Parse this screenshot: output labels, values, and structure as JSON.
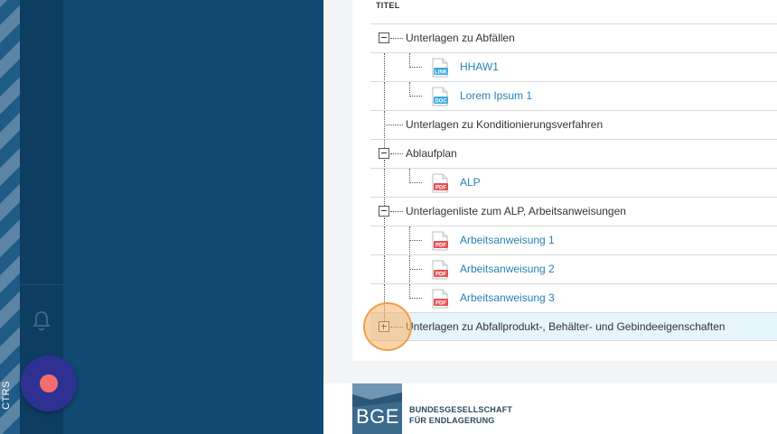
{
  "sidebar": {
    "side_label": "CTRS",
    "bell_icon": "bell-icon",
    "fab_icon": "record-dot-icon"
  },
  "table": {
    "column_header": "TITEL",
    "rows": [
      {
        "label": "Unterlagen zu Abfällen",
        "type": "folder",
        "expanded": true
      },
      {
        "label": "HHAW1",
        "type": "link",
        "icon": "link-icon"
      },
      {
        "label": "Lorem Ipsum 1",
        "type": "doc",
        "icon": "doc-icon"
      },
      {
        "label": "Unterlagen zu Konditionierungsverfahren",
        "type": "folder",
        "expanded": false
      },
      {
        "label": "Ablaufplan",
        "type": "folder",
        "expanded": true
      },
      {
        "label": "ALP",
        "type": "pdf",
        "icon": "pdf-icon"
      },
      {
        "label": "Unterlagenliste zum ALP, Arbeitsanweisungen",
        "type": "folder",
        "expanded": true
      },
      {
        "label": "Arbeitsanweisung 1",
        "type": "pdf",
        "icon": "pdf-icon"
      },
      {
        "label": "Arbeitsanweisung 2",
        "type": "pdf",
        "icon": "pdf-icon"
      },
      {
        "label": "Arbeitsanweisung 3",
        "type": "pdf",
        "icon": "pdf-icon"
      },
      {
        "label": "Unterlagen zu Abfallprodukt-, Behälter- und Gebindeeigenschaften",
        "type": "folder",
        "expanded": false
      }
    ]
  },
  "icons": {
    "link_badge": "LINK",
    "doc_badge": "DOC",
    "pdf_badge": "PDF"
  },
  "footer": {
    "logo_text": "BGE",
    "org_line1": "BUNDESGESELLSCHAFT",
    "org_line2": "FÜR ENDLAGERUNG"
  },
  "colors": {
    "accent": "#2a7fb8",
    "sidebar_dark": "#0d3e62",
    "panel": "#124a73",
    "fab": "#2e3192",
    "fab_dot": "#f26d6d",
    "pdf_red": "#e05252",
    "doc_blue": "#3aa7dd",
    "highlight": "#f7b062"
  }
}
